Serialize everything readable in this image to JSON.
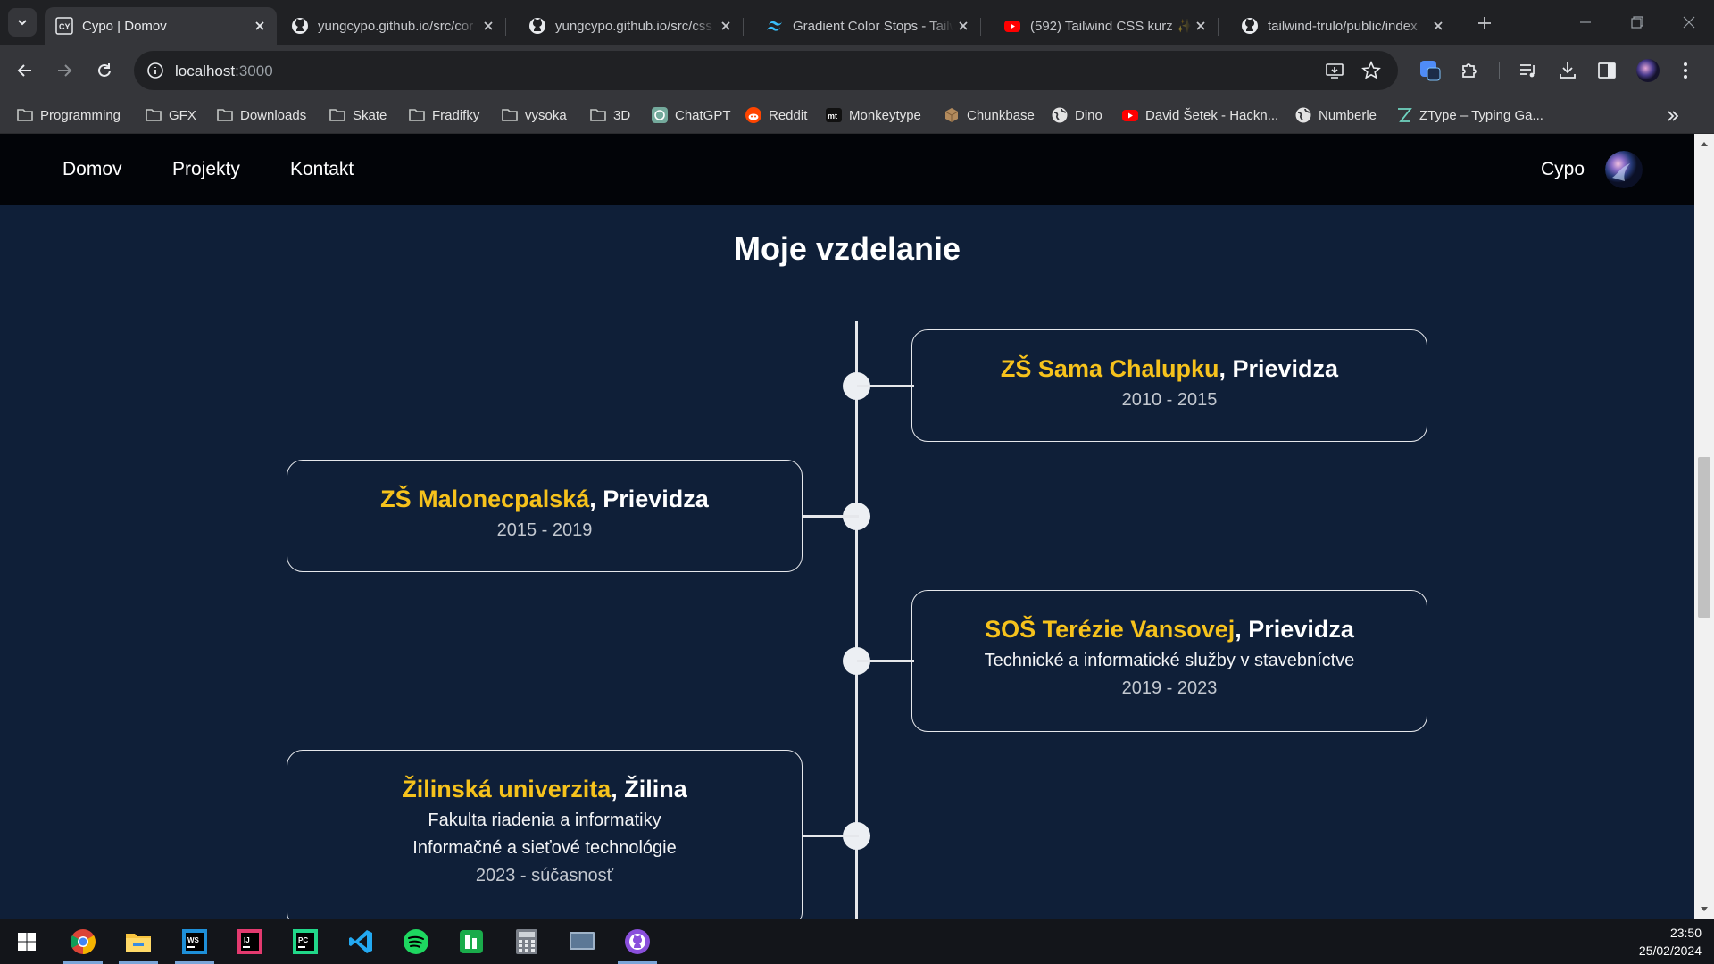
{
  "browser": {
    "tabs": [
      {
        "title": "Cypo | Domov",
        "icon": "cypo-favicon",
        "active": true
      },
      {
        "title": "yungcypo.github.io/src/cor",
        "icon": "github-icon"
      },
      {
        "title": "yungcypo.github.io/src/css",
        "icon": "github-icon"
      },
      {
        "title": "Gradient Color Stops - Tailw",
        "icon": "tailwind-icon"
      },
      {
        "title": "(592) Tailwind CSS kurz ✨",
        "icon": "youtube-icon"
      },
      {
        "title": "tailwind-trulo/public/index",
        "icon": "github-icon"
      }
    ],
    "url_host": "localhost",
    "url_port": ":3000",
    "bookmarks": [
      {
        "label": "Programming",
        "icon": "folder-icon"
      },
      {
        "label": "GFX",
        "icon": "folder-icon"
      },
      {
        "label": "Downloads",
        "icon": "folder-icon"
      },
      {
        "label": "Skate",
        "icon": "folder-icon"
      },
      {
        "label": "Fradifky",
        "icon": "folder-icon"
      },
      {
        "label": "vysoka",
        "icon": "folder-icon"
      },
      {
        "label": "3D",
        "icon": "folder-icon"
      },
      {
        "label": "ChatGPT",
        "icon": "chatgpt-icon"
      },
      {
        "label": "Reddit",
        "icon": "reddit-icon"
      },
      {
        "label": "Monkeytype",
        "icon": "monkeytype-icon"
      },
      {
        "label": "Chunkbase",
        "icon": "chunkbase-icon"
      },
      {
        "label": "Dino",
        "icon": "globe-icon"
      },
      {
        "label": "David Šetek - Hackn...",
        "icon": "youtube-icon"
      },
      {
        "label": "Numberle",
        "icon": "globe-icon"
      },
      {
        "label": "ZType – Typing Ga...",
        "icon": "ztype-icon"
      }
    ]
  },
  "site": {
    "nav": [
      "Domov",
      "Projekty",
      "Kontakt"
    ],
    "brand": "Cypo",
    "section_title": "Moje vzdelanie",
    "education": [
      {
        "name": "ZŠ Sama Chalupku",
        "place": ", Prievidza",
        "lines": [],
        "years": "2010 - 2015",
        "side": "right"
      },
      {
        "name": "ZŠ Malonecpalská",
        "place": ", Prievidza",
        "lines": [],
        "years": "2015 - 2019",
        "side": "left"
      },
      {
        "name": "SOŠ Terézie Vansovej",
        "place": ", Prievidza",
        "lines": [
          "Technické a informatické služby v stavebníctve"
        ],
        "years": "2019 - 2023",
        "side": "right"
      },
      {
        "name": "Žilinská univerzita",
        "place": ", Žilina",
        "lines": [
          "Fakulta riadenia a informatiky",
          "Informačné a sieťové technológie"
        ],
        "years": "2023 - súčasnosť",
        "side": "left"
      }
    ]
  },
  "taskbar": {
    "apps": [
      "windows-start-icon",
      "chrome-icon",
      "file-explorer-icon",
      "webstorm-icon",
      "intellij-icon",
      "pycharm-icon",
      "vscode-icon",
      "spotify-icon",
      "numbers-app-icon",
      "calculator-icon",
      "screen-app-icon",
      "github-desktop-icon"
    ],
    "time": "23:50",
    "date": "25/02/2024"
  }
}
